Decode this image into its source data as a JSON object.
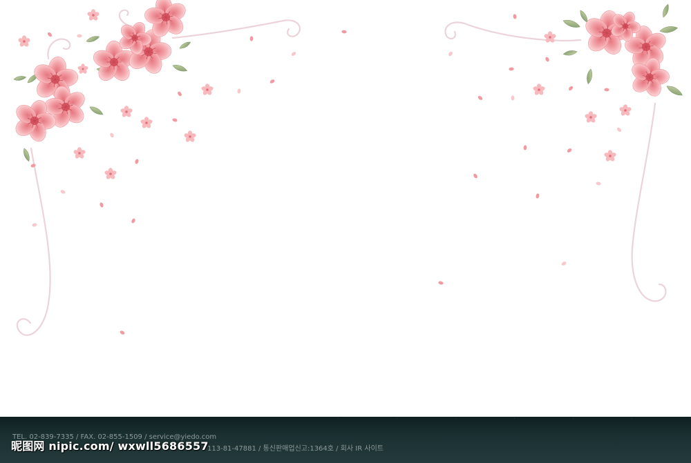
{
  "footer": {
    "line1": "TEL. 02-839-7335 / FAX. 02-855-1509 / service@yiedo.com",
    "line2_right": "113-81-47881 / 통신판매업신고:1364호 / 회사 IR 사이트",
    "watermark": "昵图网 nipic.com/ wxwll5686557"
  },
  "colors": {
    "background": "#ffffff",
    "blossom": "#f4a3a6",
    "blossom_dark": "#e87f86",
    "leaf": "#9fb38a",
    "vine": "#ecd3d9",
    "footer_bg": "#1a3031"
  }
}
